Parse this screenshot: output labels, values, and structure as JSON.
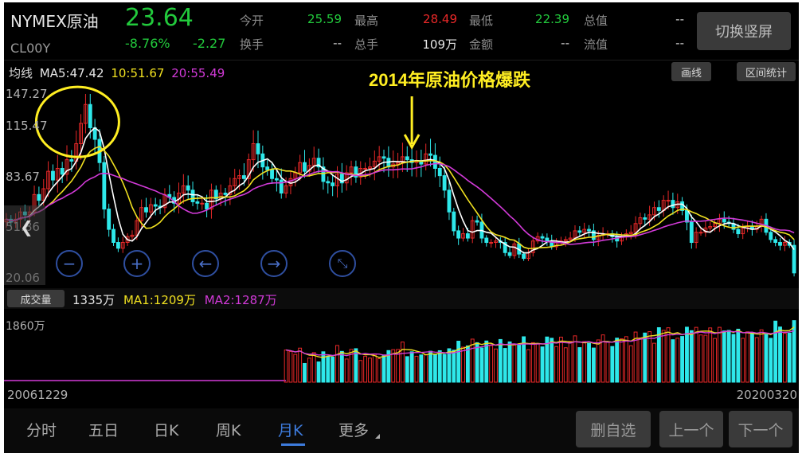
{
  "header": {
    "name": "NYMEX原油",
    "code": "CL00Y",
    "price": "23.64",
    "change_pct": "-8.76%",
    "change_abs": "-2.27",
    "stats": [
      {
        "label": "今开",
        "value": "25.59",
        "color": "#22c93c"
      },
      {
        "label": "最高",
        "value": "28.49",
        "color": "#e82828"
      },
      {
        "label": "最低",
        "value": "22.39",
        "color": "#22c93c"
      },
      {
        "label": "总值",
        "value": "--",
        "color": "#d0d0d0"
      },
      {
        "label": "换手",
        "value": "--",
        "color": "#d0d0d0"
      },
      {
        "label": "总手",
        "value": "109万",
        "color": "#e6e6e6"
      },
      {
        "label": "金额",
        "value": "--",
        "color": "#d0d0d0"
      },
      {
        "label": "流值",
        "value": "--",
        "color": "#d0d0d0"
      }
    ],
    "switch_label": "切换竖屏"
  },
  "ma_legend": {
    "label": "均线",
    "ma5": "MA5:47.42",
    "ma10": "10:51.67",
    "ma20": "20:55.49"
  },
  "tools": {
    "draw_label": "画线",
    "range_label": "区间统计"
  },
  "annotation": "2014年原油价格爆跌",
  "volume": {
    "button_label": "成交量",
    "current": "1335万",
    "ma1": "MA1:1209万",
    "ma2": "MA2:1287万",
    "max_label": "1860万"
  },
  "dates": {
    "start": "20061229",
    "end": "20200320"
  },
  "tabs": [
    {
      "label": "分时",
      "active": false
    },
    {
      "label": "五日",
      "active": false
    },
    {
      "label": "日K",
      "active": false
    },
    {
      "label": "周K",
      "active": false
    },
    {
      "label": "月K",
      "active": true
    },
    {
      "label": "更多",
      "active": false
    }
  ],
  "actions": {
    "remove_label": "删自选",
    "prev_label": "上一个",
    "next_label": "下一个"
  },
  "nav_icons": [
    "zoom-out-icon",
    "zoom-in-icon",
    "arrow-left-icon",
    "arrow-right-icon",
    "collapse-icon"
  ],
  "colors": {
    "up": "#e82828",
    "down": "#2ee8ea",
    "ma5": "#ffffff",
    "ma10": "#f0e020",
    "ma20": "#d23ad8",
    "accent": "#3d7bdc",
    "highlight": "#ffee22"
  },
  "chart_data": {
    "type": "candlestick",
    "period": "monthly",
    "x_range": [
      "20061229",
      "20200320"
    ],
    "ylim": [
      20.06,
      147.27
    ],
    "y_ticks": [
      147.27,
      115.47,
      83.67,
      51.86,
      20.06
    ],
    "series": [
      {
        "name": "MA5",
        "latest": 47.42
      },
      {
        "name": "MA10",
        "latest": 51.67
      },
      {
        "name": "MA20",
        "latest": 55.49
      }
    ],
    "close_approx": [
      61,
      59,
      61,
      66,
      64,
      66,
      78,
      74,
      82,
      94,
      88,
      96,
      92,
      102,
      101,
      113,
      127,
      140,
      124,
      116,
      100,
      68,
      54,
      45,
      41,
      45,
      49,
      50,
      60,
      69,
      66,
      71,
      70,
      69,
      78,
      76,
      72,
      79,
      84,
      81,
      73,
      72,
      72,
      68,
      81,
      75,
      79,
      78,
      84,
      89,
      91,
      89,
      102,
      113,
      106,
      97,
      95,
      89,
      88,
      79,
      84,
      89,
      93,
      100,
      94,
      98,
      103,
      97,
      87,
      86,
      84,
      92,
      86,
      93,
      97,
      90,
      96,
      96,
      97,
      101,
      104,
      103,
      97,
      99,
      100,
      104,
      102,
      100,
      101,
      99,
      106,
      105,
      96,
      91,
      81,
      66,
      53,
      48,
      51,
      48,
      60,
      59,
      48,
      45,
      45,
      46,
      45,
      38,
      36,
      44,
      37,
      34,
      38,
      46,
      49,
      48,
      46,
      42,
      45,
      46,
      47,
      48,
      53,
      52,
      54,
      53,
      47,
      50,
      51,
      51,
      49,
      46,
      49,
      51,
      52,
      58,
      62,
      61,
      64,
      69,
      67,
      74,
      74,
      69,
      73,
      67,
      59,
      45,
      52,
      52,
      55,
      56,
      58,
      61,
      59,
      58,
      54,
      51,
      55,
      56,
      54,
      56,
      61,
      52,
      47,
      45,
      43,
      45,
      43,
      24
    ],
    "volume": {
      "max": "1860万",
      "latest": "1335万",
      "ma1_latest": "1209万",
      "ma2_latest": "1287万"
    },
    "annotations": [
      {
        "text": "2014年原油价格爆跌",
        "at_x": "2014"
      }
    ]
  }
}
